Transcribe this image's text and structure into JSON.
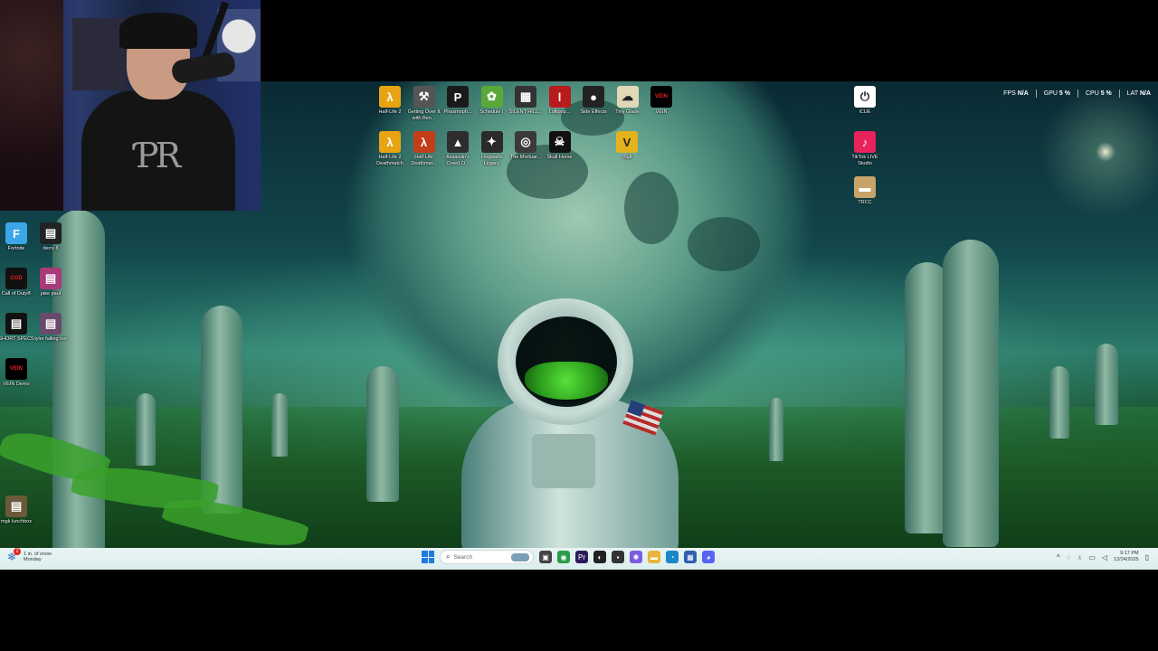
{
  "desktop_icons_top": [
    {
      "label": "Half-Life 2",
      "icon": "half-life-icon",
      "color": "#e8a313",
      "glyph": "λ"
    },
    {
      "label": "Getting Over It with Ben...",
      "icon": "hammer-icon",
      "color": "#555555",
      "glyph": "⚒"
    },
    {
      "label": "Phasmoph...",
      "icon": "phasmophobia-icon",
      "color": "#1a1a1a",
      "glyph": "P"
    },
    {
      "label": "Schedule I",
      "icon": "schedule-one-icon",
      "color": "#5aa83a",
      "glyph": "✿"
    },
    {
      "label": "SILENT HILL...",
      "icon": "silent-hill-icon",
      "color": "#333333",
      "glyph": "▦"
    },
    {
      "label": "Lollipop...",
      "icon": "lollipop-icon",
      "color": "#b81b1b",
      "glyph": "l"
    },
    {
      "label": "Side Effects",
      "icon": "side-effects-icon",
      "color": "#222222",
      "glyph": "●"
    },
    {
      "label": "Tiny Glade",
      "icon": "tiny-glade-icon",
      "color": "#e2d8b8",
      "glyph": "☁"
    },
    {
      "label": "VEIN",
      "icon": "vein-icon",
      "color": "#000000",
      "glyph": "VEIN"
    }
  ],
  "desktop_icons_second": [
    {
      "label": "Half-Life 2 Deathmatch",
      "icon": "half-life-deathmatch-icon",
      "color": "#e8a313",
      "glyph": "λ"
    },
    {
      "label": "Half-Life Deathmat...",
      "icon": "half-life-deathmatch-red-icon",
      "color": "#c23d1a",
      "glyph": "λ"
    },
    {
      "label": "Assassin's Creed O...",
      "icon": "assassins-creed-icon",
      "color": "#2d2d2d",
      "glyph": "▲"
    },
    {
      "label": "Hogwarts Legacy",
      "icon": "hogwarts-legacy-icon",
      "color": "#2a2a2a",
      "glyph": "✦"
    },
    {
      "label": "The Mortuar...",
      "icon": "mortuary-icon",
      "color": "#3a3a3a",
      "glyph": "◎"
    },
    {
      "label": "Skull Horse",
      "icon": "skull-horse-icon",
      "color": "#111111",
      "glyph": "☠"
    },
    {
      "label": "Vigil",
      "icon": "vigil-icon",
      "color": "#e3b21c",
      "glyph": "V"
    }
  ],
  "desktop_icons_right": [
    {
      "label": "iCUE",
      "icon": "icue-icon",
      "color": "#ffffff",
      "glyph": "⏻"
    },
    {
      "label": "TikTok LIVE Studio",
      "icon": "tiktok-live-studio-icon",
      "color": "#e8225a",
      "glyph": "♪"
    },
    {
      "label": "TRCC",
      "icon": "trcc-icon",
      "color": "#c9a46a",
      "glyph": "▬"
    }
  ],
  "desktop_icons_left": [
    {
      "label": "Fortnite",
      "icon": "fortnite-icon",
      "color": "#3ba6e8",
      "glyph": "F"
    },
    {
      "label": "derry 8",
      "icon": "video-file-icon",
      "color": "#222222",
      "glyph": "▤"
    },
    {
      "label": "Call of Duty®",
      "icon": "call-of-duty-icon",
      "color": "#111111",
      "glyph": "COD"
    },
    {
      "label": "jake paul",
      "icon": "video-file-icon",
      "color": "#a93a7a",
      "glyph": "▤"
    },
    {
      "label": "SHORT SPECS",
      "icon": "video-file-icon",
      "color": "#111111",
      "glyph": "▤"
    },
    {
      "label": "tyler falling too",
      "icon": "video-file-icon",
      "color": "#6a4a6a",
      "glyph": "▤"
    },
    {
      "label": "VEIN Demo",
      "icon": "vein-demo-icon",
      "color": "#000000",
      "glyph": "VEIN"
    },
    {
      "label": "mgk lunchbox",
      "icon": "video-file-icon",
      "color": "#6a5a3a",
      "glyph": "▤"
    }
  ],
  "stats_overlay": {
    "fps_label": "FPS",
    "fps_value": "N/A",
    "gpu_label": "GPU",
    "gpu_value": "5 %",
    "cpu_label": "CPU",
    "cpu_value": "5 %",
    "lat_label": "LAT",
    "lat_value": "N/A"
  },
  "taskbar": {
    "weather_line1": "1 in. of snow",
    "weather_line2": "Monday",
    "weather_badge": "2",
    "search_placeholder": "Search",
    "pinned": [
      {
        "name": "file-explorer-icon",
        "color": "#444444",
        "glyph": "▣"
      },
      {
        "name": "chrome-icon",
        "color": "#2a9d4a",
        "glyph": "◉"
      },
      {
        "name": "premiere-icon",
        "color": "#2b1a5a",
        "glyph": "Pr"
      },
      {
        "name": "obs-icon",
        "color": "#222222",
        "glyph": "◐"
      },
      {
        "name": "app-icon",
        "color": "#333333",
        "glyph": "▪"
      },
      {
        "name": "copilot-icon",
        "color": "#7b5be0",
        "glyph": "✺"
      },
      {
        "name": "folder-icon",
        "color": "#e8b53a",
        "glyph": "▬"
      },
      {
        "name": "edge-icon",
        "color": "#1b86c8",
        "glyph": "◔"
      },
      {
        "name": "settings-app-icon",
        "color": "#2f5fb0",
        "glyph": "▦"
      },
      {
        "name": "discord-icon",
        "color": "#5865f2",
        "glyph": "◕"
      }
    ],
    "clock_time": "9:17 PM",
    "clock_date": "12/24/2025"
  }
}
